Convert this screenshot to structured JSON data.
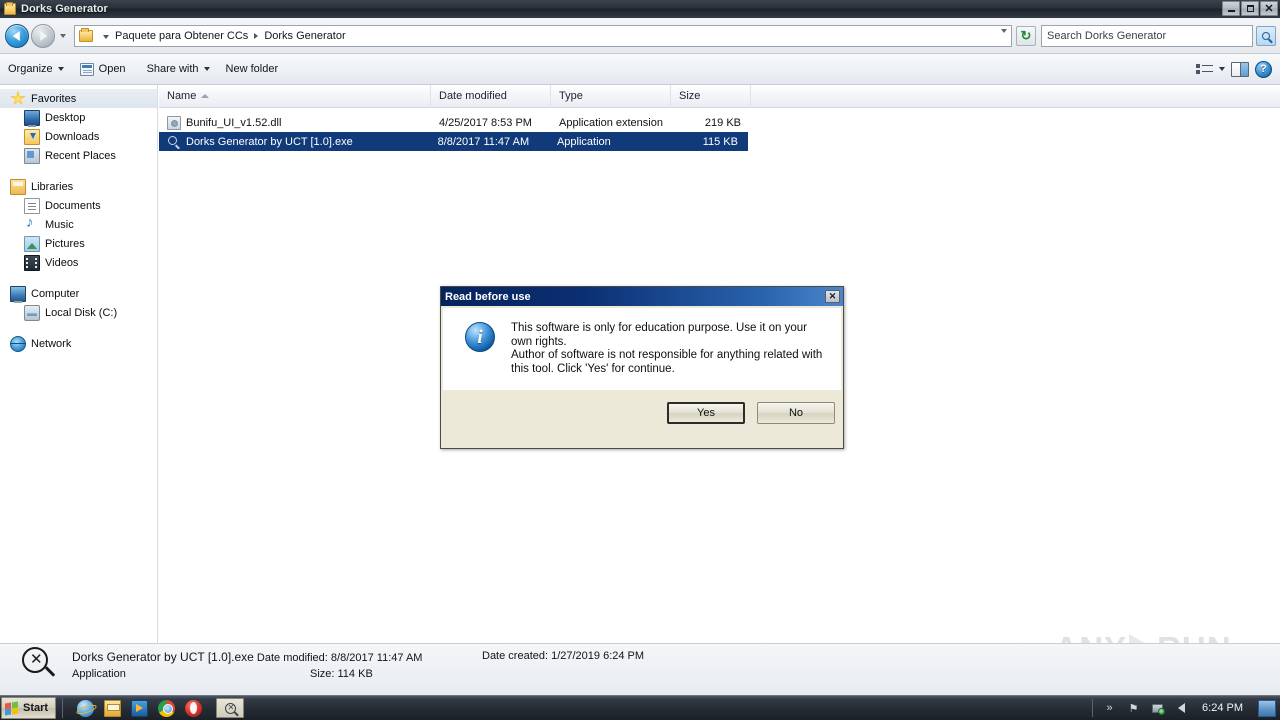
{
  "window": {
    "title": "Dorks Generator",
    "controls": {
      "minimize": "_",
      "maximize": "❐",
      "close": "✕"
    }
  },
  "address_bar": {
    "breadcrumb": [
      "Paquete para Obtener CCs",
      "Dorks Generator"
    ],
    "refresh_label": "↻",
    "search_placeholder": "Search Dorks Generator"
  },
  "command_bar": {
    "organize": "Organize",
    "open": "Open",
    "share_with": "Share with",
    "new_folder": "New folder",
    "help_label": "?"
  },
  "nav_pane": {
    "groups": [
      {
        "header": {
          "label": "Favorites",
          "icon": "star-icon"
        },
        "items": [
          {
            "label": "Desktop",
            "icon": "desktop-icon"
          },
          {
            "label": "Downloads",
            "icon": "downloads-icon"
          },
          {
            "label": "Recent Places",
            "icon": "recent-places-icon"
          }
        ]
      },
      {
        "header": {
          "label": "Libraries",
          "icon": "libraries-icon"
        },
        "items": [
          {
            "label": "Documents",
            "icon": "documents-icon"
          },
          {
            "label": "Music",
            "icon": "music-icon"
          },
          {
            "label": "Pictures",
            "icon": "pictures-icon"
          },
          {
            "label": "Videos",
            "icon": "videos-icon"
          }
        ]
      },
      {
        "header": {
          "label": "Computer",
          "icon": "computer-icon"
        },
        "items": [
          {
            "label": "Local Disk (C:)",
            "icon": "local-disk-icon"
          }
        ]
      },
      {
        "header": {
          "label": "Network",
          "icon": "network-icon"
        },
        "items": []
      }
    ]
  },
  "file_list": {
    "columns": [
      {
        "label": "Name",
        "sorted": "asc"
      },
      {
        "label": "Date modified",
        "sorted": ""
      },
      {
        "label": "Type",
        "sorted": ""
      },
      {
        "label": "Size",
        "sorted": ""
      }
    ],
    "rows": [
      {
        "name": "Bunifu_UI_v1.52.dll",
        "date_modified": "4/25/2017 8:53 PM",
        "type": "Application extension",
        "size": "219 KB",
        "selected": false,
        "icon": "dll-file-icon"
      },
      {
        "name": "Dorks Generator by UCT [1.0].exe",
        "date_modified": "8/8/2017 11:47 AM",
        "type": "Application",
        "size": "115 KB",
        "selected": true,
        "icon": "magnifier-app-icon"
      }
    ]
  },
  "status_bar": {
    "file_name": "Dorks Generator by UCT [1.0].exe",
    "date_modified_label": "Date modified: 8/8/2017 11:47 AM",
    "date_created_label": "Date created: 1/27/2019 6:24 PM",
    "type": "Application",
    "size_label": "Size: 114 KB"
  },
  "watermark": {
    "left": "ANY",
    "right": "RUN"
  },
  "dialog": {
    "title": "Read before use",
    "close_label": "✕",
    "message_line1": "This software is only for education purpose. Use it on your own rights.",
    "message_line2": "Author of software is not responsible for anything related with this tool. Click 'Yes' for continue.",
    "buttons": [
      {
        "label": "Yes",
        "default": true
      },
      {
        "label": "No",
        "default": false
      }
    ]
  },
  "taskbar": {
    "start_label": "Start",
    "quick_launch": [
      {
        "name": "internet-explorer-icon"
      },
      {
        "name": "windows-explorer-icon"
      },
      {
        "name": "media-player-icon"
      },
      {
        "name": "chrome-icon"
      },
      {
        "name": "opera-icon"
      }
    ],
    "active_task": "magnifier-app-icon",
    "tray": {
      "show_hidden": "»",
      "flag": "⚑",
      "network": "network-tray-icon",
      "volume": "◂",
      "clock": "6:24 PM"
    }
  },
  "colors": {
    "selection_blue": "#103a7a",
    "dialog_title_blue": "#0a2f72",
    "dialog_face": "#ece9d8",
    "taskbar_dark": "#262c34"
  }
}
